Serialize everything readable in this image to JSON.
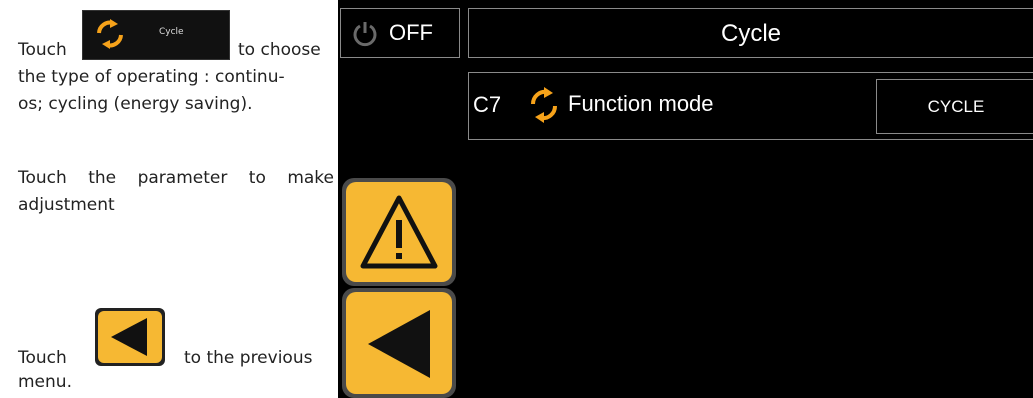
{
  "manual": {
    "p1_touch": "Touch",
    "p1_rest": "to choose",
    "p1_line2": "the type of operating : continu-",
    "p1_line3": "os; cycling (energy saving).",
    "inline_cycle_label": "Cycle",
    "p2": "Touch the parameter to make adjustment",
    "p3_touch": "Touch",
    "p3_rest": "to the previous",
    "p3_line2": "menu."
  },
  "screen": {
    "off_label": "OFF",
    "title": "Cycle",
    "param": {
      "code": "C7",
      "name": "Function mode",
      "value": "CYCLE",
      "icon": "cycle-arrows-icon"
    },
    "warning_icon": "warning-triangle-icon",
    "back_icon": "back-arrow-icon"
  },
  "colors": {
    "accent": "#f6b833",
    "screen_bg": "#000000",
    "border": "#8a8a8a"
  }
}
